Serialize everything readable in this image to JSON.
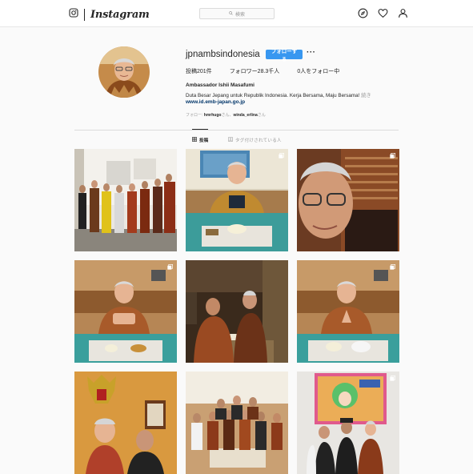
{
  "nav": {
    "brand": "Instagram",
    "search_placeholder": "検索",
    "icons": [
      "instagram-camera-icon",
      "compass-icon",
      "heart-icon",
      "person-icon",
      "search-icon"
    ]
  },
  "profile": {
    "username": "jpnambsindonesia",
    "follow_label": "フォローする",
    "more_label": "···",
    "stats": {
      "posts": "投稿201件",
      "followers": "フォロワー28.3千人",
      "following": "0人をフォロー中"
    },
    "full_name": "Ambassador Ishii Masafumi",
    "bio": "Duta Besar Jepang untuk Republik Indonesia. Kerja Bersama, Maju Bersama! ",
    "bio_tail": "続き",
    "website": "www.id.emb-japan.go.jp",
    "followed_by_prefix": "フォロー: ",
    "followed_by_1": "hmrhugo",
    "followed_by_sep": "さん、",
    "followed_by_2": "winda_erlina",
    "followed_by_suffix": "さん"
  },
  "tabs": [
    {
      "label": "投稿",
      "active": true
    },
    {
      "label": "タグ付けされている人",
      "active": false
    }
  ],
  "colors": {
    "accent": "#3897f0",
    "link": "#003569",
    "muted": "#999999",
    "border": "#dbdbdb"
  }
}
